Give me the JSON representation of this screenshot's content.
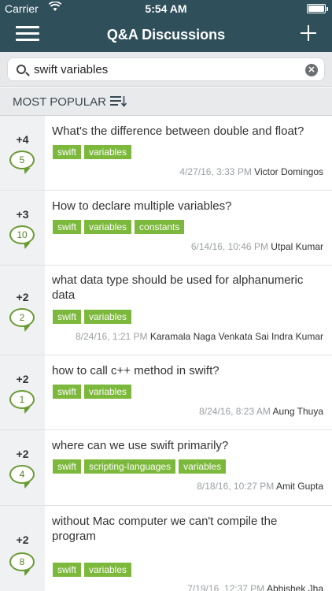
{
  "status": {
    "carrier": "Carrier",
    "time": "5:54 AM"
  },
  "nav": {
    "title": "Q&A Discussions"
  },
  "search": {
    "query": "swift variables"
  },
  "sort": {
    "label": "MOST POPULAR"
  },
  "colors": {
    "nav_bg": "#2f4f5a",
    "tag_bg": "#7cb83b",
    "bubble": "#6a9a34"
  },
  "questions": [
    {
      "votes": "+4",
      "answers": "5",
      "title": "What's the difference between double and float?",
      "tags": [
        "swift",
        "variables"
      ],
      "date": "4/27/16, 3:33 PM",
      "author": "Victor Domingos"
    },
    {
      "votes": "+3",
      "answers": "10",
      "title": "How to declare multiple variables?",
      "tags": [
        "swift",
        "variables",
        "constants"
      ],
      "date": "6/14/16, 10:46 PM",
      "author": "Utpal Kumar"
    },
    {
      "votes": "+2",
      "answers": "2",
      "title": "what data type should be used for alphanumeric data",
      "tags": [
        "swift",
        "variables"
      ],
      "date": "8/24/16, 1:21 PM",
      "author": "Karamala Naga Venkata Sai Indra Kumar"
    },
    {
      "votes": "+2",
      "answers": "1",
      "title": "how to call c++ method in swift?",
      "tags": [
        "swift",
        "variables"
      ],
      "date": "8/24/16, 8:23 AM",
      "author": "Aung Thuya"
    },
    {
      "votes": "+2",
      "answers": "4",
      "title": "where can we use swift primarily?",
      "tags": [
        "swift",
        "scripting-languages",
        "variables"
      ],
      "date": "8/18/16, 10:27 PM",
      "author": "Amit Gupta"
    },
    {
      "votes": "+2",
      "answers": "8",
      "title": "without Mac computer we can't compile the program",
      "tags": [
        "swift",
        "variables"
      ],
      "date": "7/19/16, 12:37 PM",
      "author": "Abhishek Jha"
    }
  ]
}
